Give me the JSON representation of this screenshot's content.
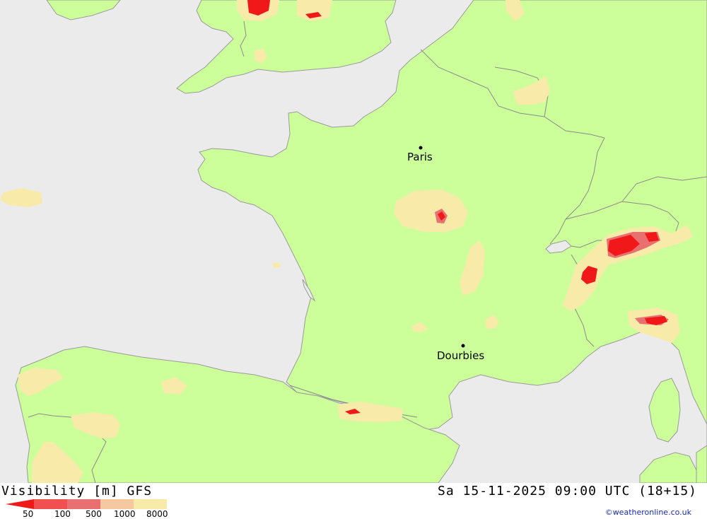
{
  "map": {
    "cities": [
      {
        "name": "Paris"
      },
      {
        "name": "Dourbies"
      }
    ],
    "colors": {
      "sea": "#ebebeb",
      "land": "#ccff99",
      "vis_8000": "#f8eaa8",
      "vis_1000": "#e87070",
      "vis_500": "#f05050",
      "vis_50": "#f01818",
      "border": "#999999"
    }
  },
  "footer": {
    "title": "Visibility [m] GFS",
    "datetime": "Sa 15-11-2025 09:00 UTC (18+15)",
    "credit": "©weatheronline.co.uk",
    "legend": {
      "labels": [
        "50",
        "100",
        "500",
        "1000",
        "8000"
      ],
      "colors": [
        "#f01818",
        "#f05050",
        "#e87070",
        "#f5c8a0",
        "#f8eaa8"
      ]
    }
  }
}
